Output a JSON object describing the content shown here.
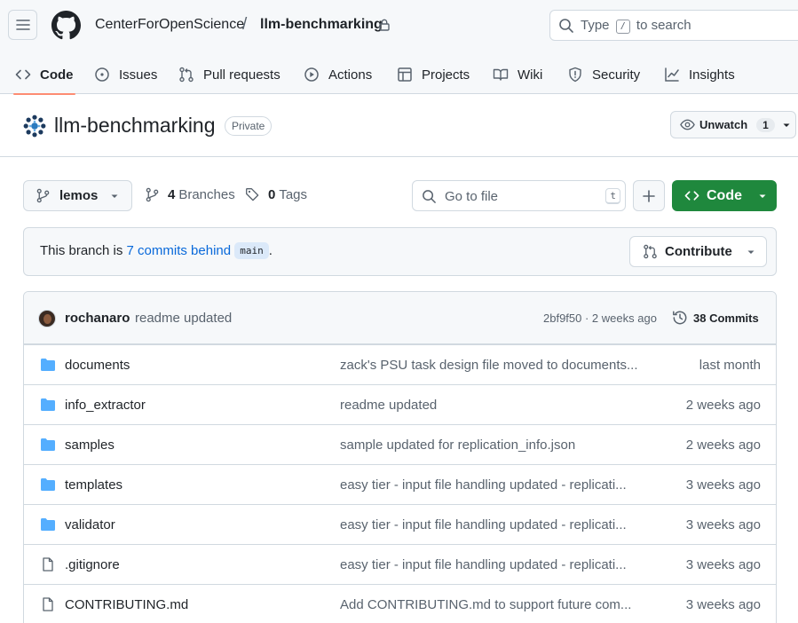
{
  "header": {
    "owner": "CenterForOpenScience",
    "separator": "/",
    "repo": "llm-benchmarking",
    "search": {
      "before": "Type",
      "key": "/",
      "after": "to search"
    }
  },
  "tabs": [
    {
      "label": "Code",
      "icon": "code-icon",
      "active": true
    },
    {
      "label": "Issues",
      "icon": "issue-icon"
    },
    {
      "label": "Pull requests",
      "icon": "pull-request-icon"
    },
    {
      "label": "Actions",
      "icon": "play-icon"
    },
    {
      "label": "Projects",
      "icon": "table-icon"
    },
    {
      "label": "Wiki",
      "icon": "book-icon"
    },
    {
      "label": "Security",
      "icon": "shield-icon"
    },
    {
      "label": "Insights",
      "icon": "graph-icon"
    }
  ],
  "repo_title": {
    "name": "llm-benchmarking",
    "visibility": "Private",
    "watch_label": "Unwatch",
    "watch_count": "1"
  },
  "branch_bar": {
    "branch": "lemos",
    "branches_count": "4",
    "branches_label": "Branches",
    "tags_count": "0",
    "tags_label": "Tags",
    "goto_placeholder": "Go to file",
    "goto_key": "t",
    "code_label": "Code"
  },
  "status": {
    "prefix": "This branch is",
    "link": "7 commits behind",
    "base": "main",
    "suffix": ".",
    "contribute_label": "Contribute"
  },
  "latest_commit": {
    "author": "rochanaro",
    "message": "readme updated",
    "hash_time": "2bf9f50 · 2 weeks ago",
    "commits_label": "38 Commits"
  },
  "files": [
    {
      "name": "documents",
      "type": "folder",
      "message": "zack's PSU task design file moved to documents...",
      "date": "last month"
    },
    {
      "name": "info_extractor",
      "type": "folder",
      "message": "readme updated",
      "date": "2 weeks ago"
    },
    {
      "name": "samples",
      "type": "folder",
      "message": "sample updated for replication_info.json",
      "date": "2 weeks ago"
    },
    {
      "name": "templates",
      "type": "folder",
      "message": "easy tier - input file handling updated - replicati...",
      "date": "3 weeks ago"
    },
    {
      "name": "validator",
      "type": "folder",
      "message": "easy tier - input file handling updated - replicati...",
      "date": "3 weeks ago"
    },
    {
      "name": ".gitignore",
      "type": "file",
      "message": "easy tier - input file handling updated - replicati...",
      "date": "3 weeks ago"
    },
    {
      "name": "CONTRIBUTING.md",
      "type": "file",
      "message": "Add CONTRIBUTING.md to support future com...",
      "date": "3 weeks ago"
    }
  ],
  "colors": {
    "primary_button": "#1f883d",
    "link": "#0969da",
    "active_tab_underline": "#fd8c73",
    "folder": "#54aeff"
  }
}
